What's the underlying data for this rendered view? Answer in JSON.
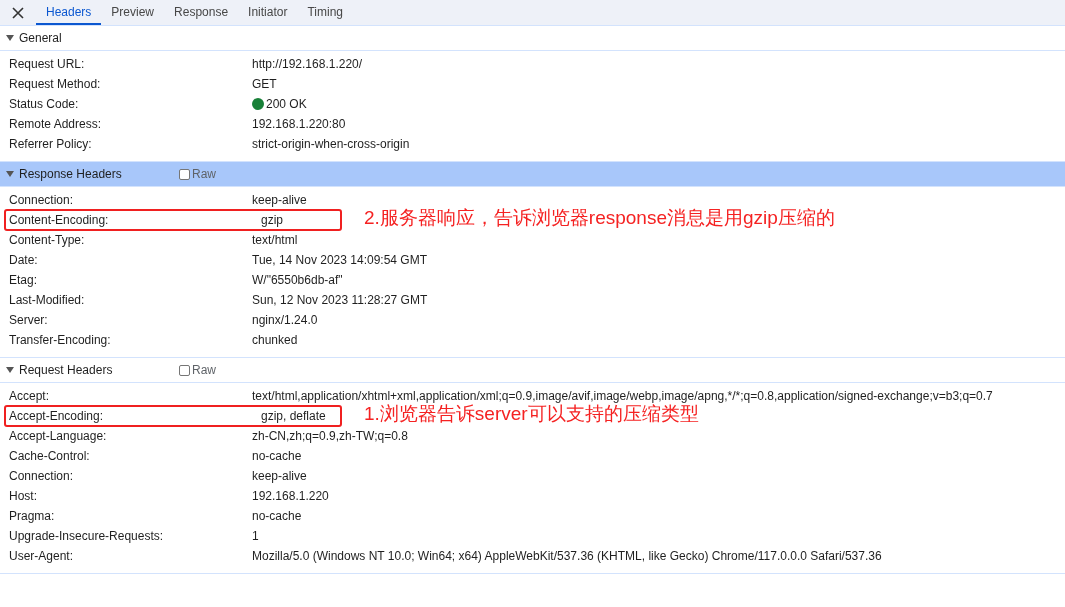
{
  "tabs": [
    {
      "label": "Headers",
      "selected": true
    },
    {
      "label": "Preview",
      "selected": false
    },
    {
      "label": "Response",
      "selected": false
    },
    {
      "label": "Initiator",
      "selected": false
    },
    {
      "label": "Timing",
      "selected": false
    }
  ],
  "sections": [
    {
      "title": "General",
      "expanded": true,
      "selected": false,
      "rows": [
        {
          "name": "Request URL:",
          "value": "http://192.168.1.220/"
        },
        {
          "name": "Request Method:",
          "value": "GET"
        },
        {
          "name": "Status Code:",
          "value": "200 OK",
          "color": "#188038"
        },
        {
          "name": "Remote Address:",
          "value": "192.168.1.220:80"
        },
        {
          "name": "Referrer Policy:",
          "value": "strict-origin-when-cross-origin"
        }
      ]
    },
    {
      "title": "Response Headers",
      "expanded": true,
      "selected": true,
      "raw": {
        "label": "Raw",
        "checked": false
      },
      "rows": [
        {
          "name": "Connection:",
          "value": "keep-alive"
        },
        {
          "name": "Content-Encoding:",
          "value": "gzip",
          "note": "2.服务器响应，告诉浏览器response消息是用gzip压缩的"
        },
        {
          "name": "Content-Type:",
          "value": "text/html"
        },
        {
          "name": "Date:",
          "value": "Tue, 14 Nov 2023 14:09:54 GMT"
        },
        {
          "name": "Etag:",
          "value": "W/\"6550b6db-af\""
        },
        {
          "name": "Last-Modified:",
          "value": "Sun, 12 Nov 2023 11:28:27 GMT"
        },
        {
          "name": "Server:",
          "value": "nginx/1.24.0"
        },
        {
          "name": "Transfer-Encoding:",
          "value": "chunked"
        }
      ]
    },
    {
      "title": "Request Headers",
      "expanded": true,
      "selected": false,
      "raw": {
        "label": "Raw",
        "checked": false
      },
      "rows": [
        {
          "name": "Accept:",
          "value": "text/html,application/xhtml+xml,application/xml;q=0.9,image/avif,image/webp,image/apng,*/*;q=0.8,application/signed-exchange;v=b3;q=0.7"
        },
        {
          "name": "Accept-Encoding:",
          "value": "gzip, deflate",
          "note": "1.浏览器告诉server可以支持的压缩类型"
        },
        {
          "name": "Accept-Language:",
          "value": "zh-CN,zh;q=0.9,zh-TW;q=0.8"
        },
        {
          "name": "Cache-Control:",
          "value": "no-cache"
        },
        {
          "name": "Connection:",
          "value": "keep-alive"
        },
        {
          "name": "Host:",
          "value": "192.168.1.220"
        },
        {
          "name": "Pragma:",
          "value": "no-cache"
        },
        {
          "name": "Upgrade-Insecure-Requests:",
          "value": "1"
        },
        {
          "name": "User-Agent:",
          "value": "Mozilla/5.0 (Windows NT 10.0; Win64; x64) AppleWebKit/537.36 (KHTML, like Gecko) Chrome/117.0.0.0 Safari/537.36"
        }
      ]
    }
  ]
}
